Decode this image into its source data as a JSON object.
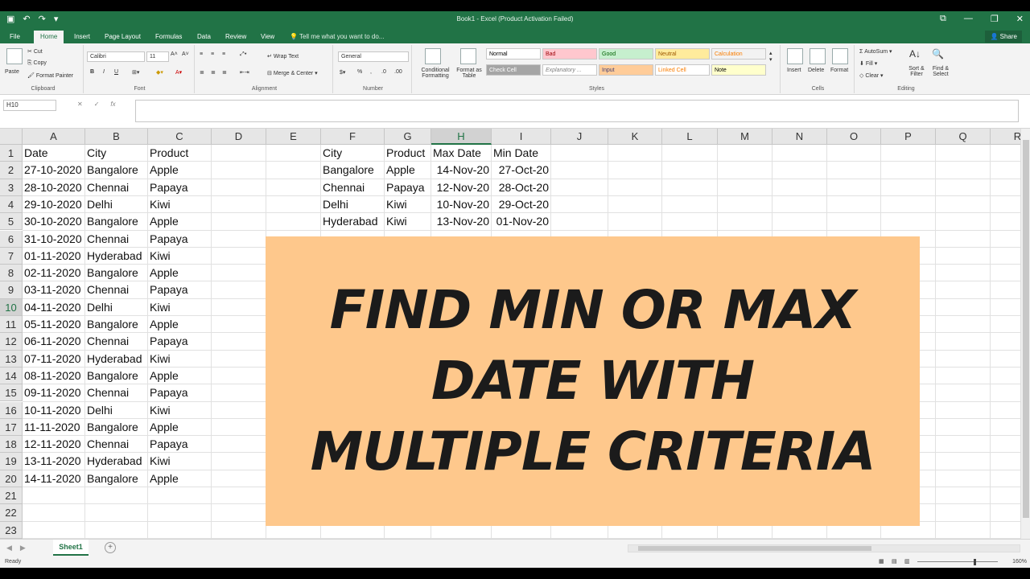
{
  "window": {
    "title": "Book1 - Excel (Product Activation Failed)"
  },
  "ribbon": {
    "tabs": [
      "File",
      "Home",
      "Insert",
      "Page Layout",
      "Formulas",
      "Data",
      "Review",
      "View"
    ],
    "tell_me": "Tell me what you want to do...",
    "share": "Share",
    "clipboard": {
      "paste": "Paste",
      "cut": "Cut",
      "copy": "Copy",
      "format_painter": "Format Painter",
      "label": "Clipboard"
    },
    "font": {
      "name": "Calibri",
      "size": "11",
      "label": "Font",
      "bold": "B",
      "italic": "I",
      "underline": "U"
    },
    "alignment": {
      "wrap_text": "Wrap Text",
      "merge_center": "Merge & Center",
      "label": "Alignment"
    },
    "number": {
      "format": "General",
      "label": "Number"
    },
    "styles": {
      "conditional": "Conditional Formatting",
      "format_as_table": "Format as Table",
      "label": "Styles",
      "cells": [
        {
          "name": "Normal",
          "bg": "#ffffff",
          "fg": "#000000"
        },
        {
          "name": "Bad",
          "bg": "#ffc7ce",
          "fg": "#9c0006"
        },
        {
          "name": "Good",
          "bg": "#c6efce",
          "fg": "#006100"
        },
        {
          "name": "Neutral",
          "bg": "#ffeb9c",
          "fg": "#9c5700"
        },
        {
          "name": "Calculation",
          "bg": "#f2f2f2",
          "fg": "#fa7d00"
        },
        {
          "name": "Check Cell",
          "bg": "#a5a5a5",
          "fg": "#ffffff"
        },
        {
          "name": "Explanatory ...",
          "bg": "#ffffff",
          "fg": "#7f7f7f"
        },
        {
          "name": "Input",
          "bg": "#ffcc99",
          "fg": "#3f3f76"
        },
        {
          "name": "Linked Cell",
          "bg": "#ffffff",
          "fg": "#fa7d00"
        },
        {
          "name": "Note",
          "bg": "#ffffcc",
          "fg": "#000000"
        }
      ]
    },
    "cells_group": {
      "insert": "Insert",
      "delete": "Delete",
      "format": "Format",
      "label": "Cells"
    },
    "editing": {
      "autosum": "AutoSum",
      "fill": "Fill",
      "clear": "Clear",
      "sort_filter": "Sort & Filter",
      "find_select": "Find & Select",
      "label": "Editing"
    }
  },
  "formula_bar": {
    "name_box": "H10",
    "fx": "fx"
  },
  "columns": [
    "A",
    "B",
    "C",
    "D",
    "E",
    "F",
    "G",
    "H",
    "I",
    "J",
    "K",
    "L",
    "M",
    "N",
    "O",
    "P",
    "Q",
    "R"
  ],
  "rows": [
    "1",
    "2",
    "3",
    "4",
    "5",
    "6",
    "7",
    "8",
    "9",
    "10",
    "11",
    "12",
    "13",
    "14",
    "15",
    "16",
    "17",
    "18",
    "19",
    "20",
    "21",
    "22",
    "23"
  ],
  "table1": {
    "headers": [
      "Date",
      "City",
      "Product"
    ],
    "rows": [
      [
        "27-10-2020",
        "Bangalore",
        "Apple"
      ],
      [
        "28-10-2020",
        "Chennai",
        "Papaya"
      ],
      [
        "29-10-2020",
        "Delhi",
        "Kiwi"
      ],
      [
        "30-10-2020",
        "Bangalore",
        "Apple"
      ],
      [
        "31-10-2020",
        "Chennai",
        "Papaya"
      ],
      [
        "01-11-2020",
        "Hyderabad",
        "Kiwi"
      ],
      [
        "02-11-2020",
        "Bangalore",
        "Apple"
      ],
      [
        "03-11-2020",
        "Chennai",
        "Papaya"
      ],
      [
        "04-11-2020",
        "Delhi",
        "Kiwi"
      ],
      [
        "05-11-2020",
        "Bangalore",
        "Apple"
      ],
      [
        "06-11-2020",
        "Chennai",
        "Papaya"
      ],
      [
        "07-11-2020",
        "Hyderabad",
        "Kiwi"
      ],
      [
        "08-11-2020",
        "Bangalore",
        "Apple"
      ],
      [
        "09-11-2020",
        "Chennai",
        "Papaya"
      ],
      [
        "10-11-2020",
        "Delhi",
        "Kiwi"
      ],
      [
        "11-11-2020",
        "Bangalore",
        "Apple"
      ],
      [
        "12-11-2020",
        "Chennai",
        "Papaya"
      ],
      [
        "13-11-2020",
        "Hyderabad",
        "Kiwi"
      ],
      [
        "14-11-2020",
        "Bangalore",
        "Apple"
      ]
    ]
  },
  "table2": {
    "headers": [
      "City",
      "Product",
      "Max Date",
      "Min Date"
    ],
    "rows": [
      [
        "Bangalore",
        "Apple",
        "14-Nov-20",
        "27-Oct-20"
      ],
      [
        "Chennai",
        "Papaya",
        "12-Nov-20",
        "28-Oct-20"
      ],
      [
        "Delhi",
        "Kiwi",
        "10-Nov-20",
        "29-Oct-20"
      ],
      [
        "Hyderabad",
        "Kiwi",
        "13-Nov-20",
        "01-Nov-20"
      ]
    ]
  },
  "banner": {
    "lines": [
      "FIND MIN OR MAX",
      "DATE WITH",
      "MULTIPLE CRITERIA"
    ],
    "bg": "#fec88c"
  },
  "sheets": [
    "Sheet1"
  ],
  "status": {
    "ready": "Ready",
    "zoom": "160%"
  },
  "colors": {
    "excel_green": "#217346"
  }
}
